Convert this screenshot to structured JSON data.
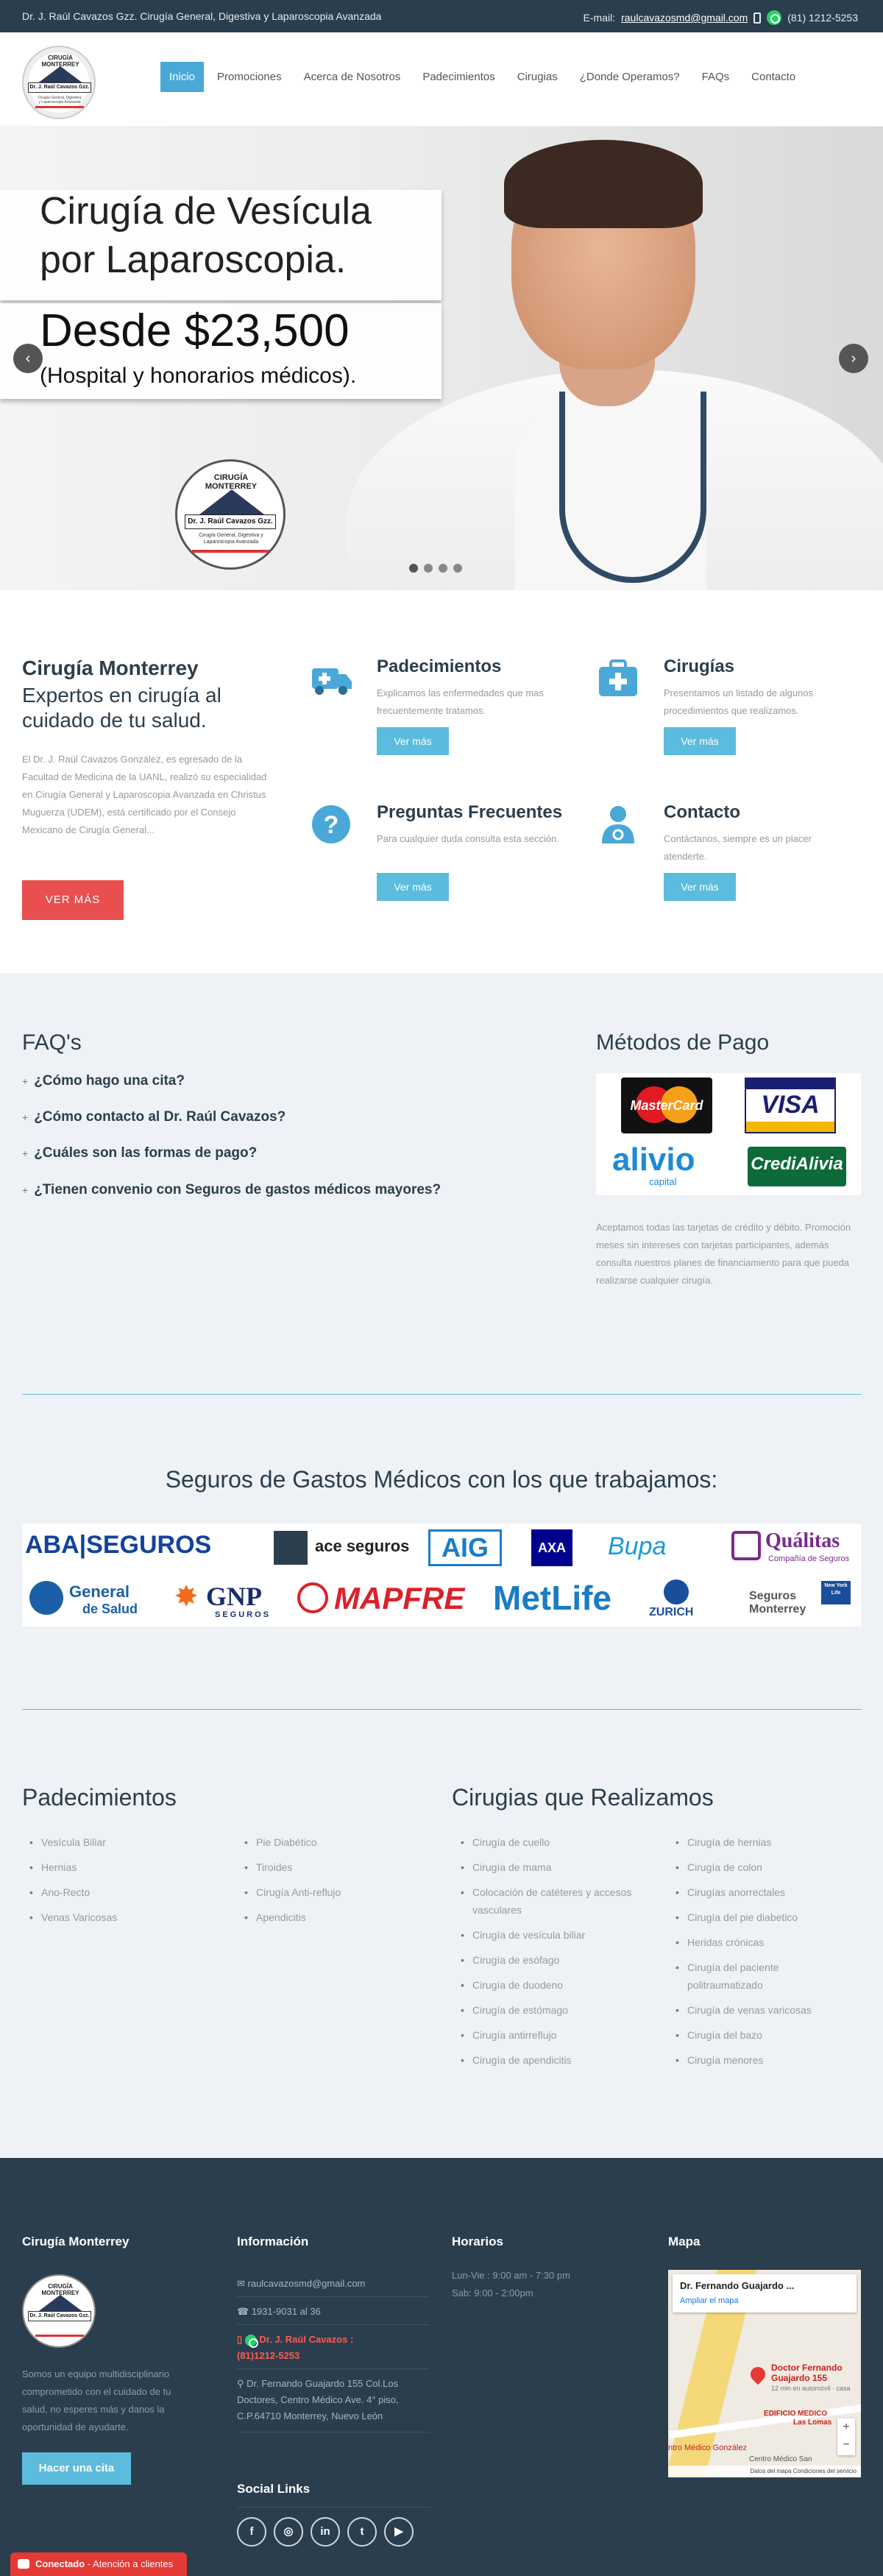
{
  "topbar": {
    "left_text": "Dr. J. Raúl Cavazos Gzz. Cirugía General, Digestiva y Laparoscopia Avanzada",
    "email_label": "E-mail:",
    "email": "raulcavazosmd@gmail.com",
    "phone": "(81) 1212-5253"
  },
  "logo": {
    "arc": "CIRUGÍA MONTERREY",
    "band": "Dr. J. Raúl Cavazos Gzz.",
    "sub": "Cirugía General, Digestiva y Laparoscopia Avanzada"
  },
  "nav": {
    "items": [
      "Inicio",
      "Promociones",
      "Acerca de Nosotros",
      "Padecimientos",
      "Cirugias",
      "¿Donde Operamos?",
      "FAQs",
      "Contacto"
    ]
  },
  "hero": {
    "title": "Cirugía de Vesícula por Laparoscopia.",
    "price": "Desde $23,500",
    "note": "(Hospital y honorarios médicos)."
  },
  "about": {
    "title": "Cirugía Monterrey",
    "lead": "Expertos en cirugía al cuidado de tu salud.",
    "desc": "El Dr. J. Raúl Cavazos González, es egresado de la Facultad de Medicina de la UANL, realizó su especialidad en Cirugía General y Laparoscopia Avanzada en Christus Muguerza (UDEM), está certificado por el Consejo Mexicano de Cirugía General...",
    "button": "VER MÁS"
  },
  "features": [
    {
      "title": "Padecimientos",
      "text": "Explicamos las enfermedades que mas frecuentemente tratamos.",
      "button": "Ver más",
      "icon": "ambulance-icon"
    },
    {
      "title": "Cirugías",
      "text": "Presentamos un listado de algunos procedimientos que realizamos.",
      "button": "Ver más",
      "icon": "medical-kit-icon"
    },
    {
      "title": "Preguntas Frecuentes",
      "text": "Para cualquier duda consulta esta sección.",
      "button": "Ver más",
      "icon": "question-icon"
    },
    {
      "title": "Contacto",
      "text": "Contáctanos, siempre es un placer atenderte.",
      "button": "Ver más",
      "icon": "doctor-icon"
    }
  ],
  "faq": {
    "title": "FAQ's",
    "items": [
      "¿Cómo hago una cita?",
      "¿Cómo contacto al Dr. Raúl Cavazos?",
      "¿Cuáles son las formas de pago?",
      "¿Tienen convenio con Seguros de gastos médicos mayores?"
    ]
  },
  "payment": {
    "title": "Métodos de Pago",
    "logos": [
      "MasterCard",
      "VISA",
      "alivio",
      "capital",
      "CrediAlivia"
    ],
    "text": "Aceptamos todas las tarjetas de crédito y débito. Promoción meses sin intereses con tarjetas participantes, además consulta nuestros planes de financiamiento para que pueda realizarse cualquier cirugía."
  },
  "insurance": {
    "title": "Seguros de Gastos Médicos con los que trabajamos:",
    "brands": [
      "ABA|SEGUROS",
      "ace seguros",
      "AIG",
      "AXA",
      "Bupa",
      "Quálitas",
      "Compañía de Seguros",
      "General",
      "de Salud",
      "GNP",
      "SEGUROS",
      "MAPFRE",
      "MetLife",
      "ZURICH",
      "Seguros",
      "Monterrey",
      "New York Life"
    ]
  },
  "lists": {
    "padecimientos_title": "Padecimientos",
    "padecimientos_col1": [
      "Vesícula Biliar",
      "Hernias",
      "Ano-Recto",
      "Venas Varicosas"
    ],
    "padecimientos_col2": [
      "Pie Diabético",
      "Tiroides",
      "Cirugía Anti-reflujo",
      "Apendicitis"
    ],
    "cirugias_title": "Cirugias que Realizamos",
    "cirugias_col1": [
      "Cirugía de cuello",
      "Cirugía de mama",
      "Colocación de catéteres y accesos vasculares",
      "Cirugía de vesícula biliar",
      "Cirugía de esófago",
      "Cirugía de duodeno",
      "Cirugía de estómago",
      "Cirugía antirreflujo",
      "Cirugía de apendicitis"
    ],
    "cirugias_col2": [
      "Cirugía de hernias",
      "Cirugía de colon",
      "Cirugías anorrectales",
      "Cirugía del pie diabetico",
      "Heridas crónicas",
      "Cirugía del paciente politraumatizado",
      "Cirugía de venas varicosas",
      "Cirugía del bazo",
      "Cirugía menores"
    ]
  },
  "footer": {
    "col1_title": "Cirugía Monterrey",
    "col1_desc": "Somos un equipo multidisciplinario comprometido con el cuidado de tu salud, no esperes más y danos la oportunidad de ayudarte.",
    "col1_button": "Hacer una cita",
    "col2_title": "Información",
    "email": "raulcavazosmd@gmail.com",
    "phone1": "1931-9031 al 36",
    "mobile_label": "Dr. J. Raúl Cavazos :",
    "mobile": "(81)1212-5253",
    "address": "Dr. Fernando Guajardo 155 Col.Los Doctores, Centro Médico Ave. 4° piso, C.P.64710 Monterrey, Nuevo León",
    "social_title": "Social Links",
    "col3_title": "Horarios",
    "hours1": "Lun-Vie : 9:00 am - 7:30 pm",
    "hours2": "Sab: 9:00 - 2:00pm",
    "col4_title": "Mapa",
    "map_card_title": "Dr. Fernando Guajardo ...",
    "map_card_link": "Ampliar el mapa",
    "map_pin_label": "Doctor Fernando Guajardo 155",
    "map_pin_sub": "12 min en automóvil · casa",
    "map_place1": "EDIFICIO MEDICO",
    "map_place2": "Las Lomas",
    "map_place3": "ntro Médico González",
    "map_place4": "Centro Médico San",
    "map_footer": "Datos del mapa   Condiciones del servicio"
  },
  "chat": {
    "status": "Conectado",
    "label": "- Atención a clientes"
  },
  "colors": {
    "topbar": "#2b3e4d",
    "accent": "#5bbcdd",
    "nav_active": "#4aa8d8",
    "red": "#e94f4f",
    "light_bg": "#eef2f6"
  }
}
